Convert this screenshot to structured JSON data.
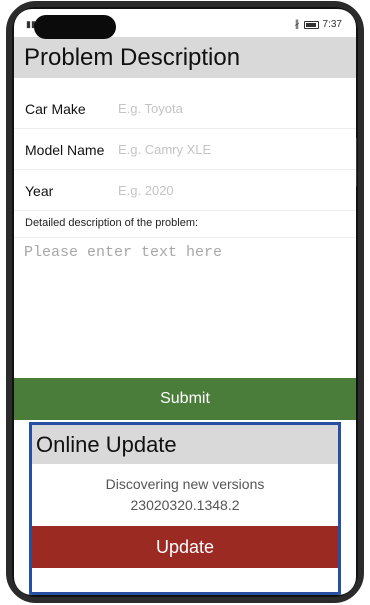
{
  "status_bar": {
    "time": "7:37",
    "left_icons": "▮▮▯ ⊙ •",
    "bluetooth_icon": "bluetooth-icon"
  },
  "problem": {
    "title": "Problem Description",
    "fields": [
      {
        "label": "Car Make",
        "placeholder": "E.g. Toyota",
        "value": ""
      },
      {
        "label": "Model Name",
        "placeholder": "E.g. Camry XLE",
        "value": ""
      },
      {
        "label": "Year",
        "placeholder": "E.g. 2020",
        "value": ""
      }
    ],
    "detail_label": "Detailed description of the problem:",
    "detail_placeholder": "Please enter text here",
    "submit_label": "Submit"
  },
  "online_update": {
    "title": "Online Update",
    "status": "Discovering new versions",
    "version": "23020320.1348.2",
    "button_label": "Update"
  },
  "colors": {
    "submit": "#4b7d3a",
    "update": "#9b2a23",
    "panel_border": "#2750a3",
    "header_bg": "#d9d9d9"
  }
}
